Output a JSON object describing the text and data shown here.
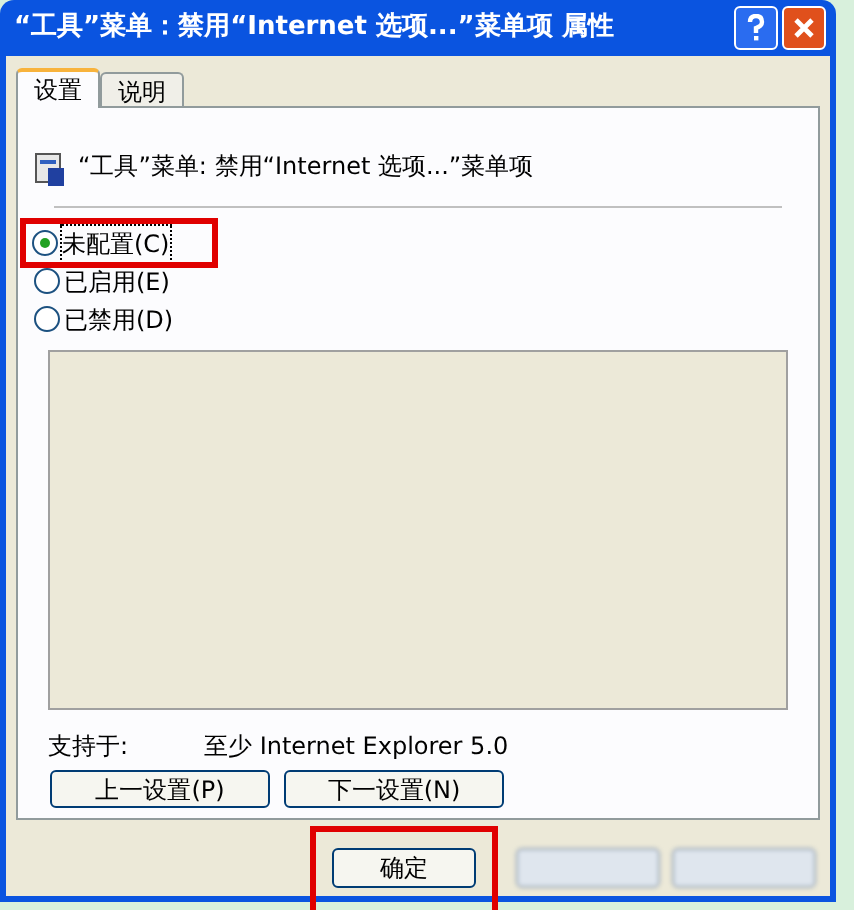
{
  "window": {
    "title": "“工具”菜单：禁用“Internet 选项...”菜单项 属性"
  },
  "tabs": [
    {
      "label": "设置",
      "selected": true
    },
    {
      "label": "说明",
      "selected": false
    }
  ],
  "policy": {
    "title": "“工具”菜单: 禁用“Internet 选项...”菜单项"
  },
  "options": [
    {
      "label": "未配置(C)",
      "selected": true,
      "highlighted": true
    },
    {
      "label": "已启用(E)",
      "selected": false,
      "highlighted": false
    },
    {
      "label": "已禁用(D)",
      "selected": false,
      "highlighted": false
    }
  ],
  "supported": {
    "label": "支持于:",
    "value": "至少 Internet Explorer 5.0"
  },
  "nav_buttons": [
    {
      "label": "上一设置(P)"
    },
    {
      "label": "下一设置(N)"
    }
  ],
  "dialog_buttons": [
    {
      "label": "确定",
      "highlighted": true,
      "blurred": false
    },
    {
      "highlighted": false,
      "blurred": true
    },
    {
      "highlighted": false,
      "blurred": true
    }
  ]
}
